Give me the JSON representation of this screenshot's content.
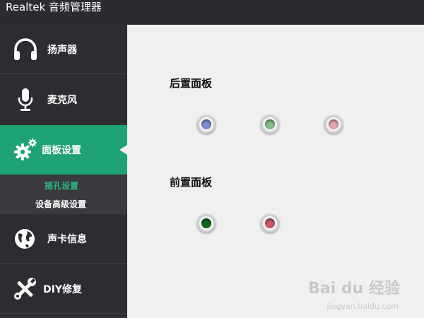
{
  "window": {
    "title": "Realtek 音频管理器"
  },
  "sidebar": {
    "items": [
      {
        "label": "扬声器",
        "icon": "headphones-icon"
      },
      {
        "label": "麦克风",
        "icon": "microphone-icon"
      },
      {
        "label": "面板设置",
        "icon": "gears-icon",
        "active": true
      },
      {
        "label": "声卡信息",
        "icon": "globe-icon"
      },
      {
        "label": "DIY修复",
        "icon": "wrench-icon"
      }
    ],
    "subitems": [
      {
        "label": "插孔设置",
        "active": true
      },
      {
        "label": "设备高级设置"
      }
    ]
  },
  "main": {
    "rear_panel": {
      "title": "后置面板",
      "jacks": [
        {
          "color": "#7a8fcf"
        },
        {
          "color": "#7fbf7f"
        },
        {
          "color": "#e0a8ad"
        }
      ]
    },
    "front_panel": {
      "title": "前置面板",
      "jacks": [
        {
          "color": "#0a6a1a"
        },
        {
          "color": "#c75a6c"
        }
      ]
    }
  },
  "theme": {
    "accent": "#1fa274",
    "sidebar_bg": "#2d2c31",
    "titlebar_bg": "#2c2b31",
    "content_bg": "#f0f0f0"
  },
  "watermark": {
    "text": "Bai du 经验",
    "sub": "jingyan.baidu.com"
  }
}
